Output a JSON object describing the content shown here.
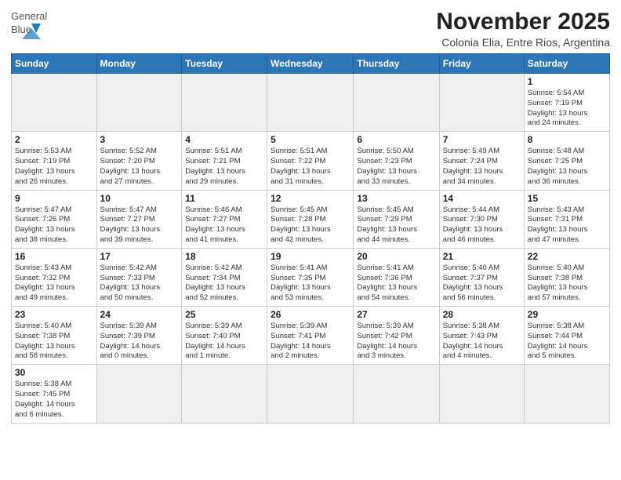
{
  "header": {
    "logo": {
      "general": "General",
      "blue": "Blue"
    },
    "month": "November 2025",
    "location": "Colonia Elia, Entre Rios, Argentina"
  },
  "weekdays": [
    "Sunday",
    "Monday",
    "Tuesday",
    "Wednesday",
    "Thursday",
    "Friday",
    "Saturday"
  ],
  "weeks": [
    [
      {
        "day": "",
        "info": ""
      },
      {
        "day": "",
        "info": ""
      },
      {
        "day": "",
        "info": ""
      },
      {
        "day": "",
        "info": ""
      },
      {
        "day": "",
        "info": ""
      },
      {
        "day": "",
        "info": ""
      },
      {
        "day": "1",
        "info": "Sunrise: 5:54 AM\nSunset: 7:19 PM\nDaylight: 13 hours\nand 24 minutes."
      }
    ],
    [
      {
        "day": "2",
        "info": "Sunrise: 5:53 AM\nSunset: 7:19 PM\nDaylight: 13 hours\nand 26 minutes."
      },
      {
        "day": "3",
        "info": "Sunrise: 5:52 AM\nSunset: 7:20 PM\nDaylight: 13 hours\nand 27 minutes."
      },
      {
        "day": "4",
        "info": "Sunrise: 5:51 AM\nSunset: 7:21 PM\nDaylight: 13 hours\nand 29 minutes."
      },
      {
        "day": "5",
        "info": "Sunrise: 5:51 AM\nSunset: 7:22 PM\nDaylight: 13 hours\nand 31 minutes."
      },
      {
        "day": "6",
        "info": "Sunrise: 5:50 AM\nSunset: 7:23 PM\nDaylight: 13 hours\nand 33 minutes."
      },
      {
        "day": "7",
        "info": "Sunrise: 5:49 AM\nSunset: 7:24 PM\nDaylight: 13 hours\nand 34 minutes."
      },
      {
        "day": "8",
        "info": "Sunrise: 5:48 AM\nSunset: 7:25 PM\nDaylight: 13 hours\nand 36 minutes."
      }
    ],
    [
      {
        "day": "9",
        "info": "Sunrise: 5:47 AM\nSunset: 7:26 PM\nDaylight: 13 hours\nand 38 minutes."
      },
      {
        "day": "10",
        "info": "Sunrise: 5:47 AM\nSunset: 7:27 PM\nDaylight: 13 hours\nand 39 minutes."
      },
      {
        "day": "11",
        "info": "Sunrise: 5:46 AM\nSunset: 7:27 PM\nDaylight: 13 hours\nand 41 minutes."
      },
      {
        "day": "12",
        "info": "Sunrise: 5:45 AM\nSunset: 7:28 PM\nDaylight: 13 hours\nand 42 minutes."
      },
      {
        "day": "13",
        "info": "Sunrise: 5:45 AM\nSunset: 7:29 PM\nDaylight: 13 hours\nand 44 minutes."
      },
      {
        "day": "14",
        "info": "Sunrise: 5:44 AM\nSunset: 7:30 PM\nDaylight: 13 hours\nand 46 minutes."
      },
      {
        "day": "15",
        "info": "Sunrise: 5:43 AM\nSunset: 7:31 PM\nDaylight: 13 hours\nand 47 minutes."
      }
    ],
    [
      {
        "day": "16",
        "info": "Sunrise: 5:43 AM\nSunset: 7:32 PM\nDaylight: 13 hours\nand 49 minutes."
      },
      {
        "day": "17",
        "info": "Sunrise: 5:42 AM\nSunset: 7:33 PM\nDaylight: 13 hours\nand 50 minutes."
      },
      {
        "day": "18",
        "info": "Sunrise: 5:42 AM\nSunset: 7:34 PM\nDaylight: 13 hours\nand 52 minutes."
      },
      {
        "day": "19",
        "info": "Sunrise: 5:41 AM\nSunset: 7:35 PM\nDaylight: 13 hours\nand 53 minutes."
      },
      {
        "day": "20",
        "info": "Sunrise: 5:41 AM\nSunset: 7:36 PM\nDaylight: 13 hours\nand 54 minutes."
      },
      {
        "day": "21",
        "info": "Sunrise: 5:40 AM\nSunset: 7:37 PM\nDaylight: 13 hours\nand 56 minutes."
      },
      {
        "day": "22",
        "info": "Sunrise: 5:40 AM\nSunset: 7:38 PM\nDaylight: 13 hours\nand 57 minutes."
      }
    ],
    [
      {
        "day": "23",
        "info": "Sunrise: 5:40 AM\nSunset: 7:38 PM\nDaylight: 13 hours\nand 58 minutes."
      },
      {
        "day": "24",
        "info": "Sunrise: 5:39 AM\nSunset: 7:39 PM\nDaylight: 14 hours\nand 0 minutes."
      },
      {
        "day": "25",
        "info": "Sunrise: 5:39 AM\nSunset: 7:40 PM\nDaylight: 14 hours\nand 1 minute."
      },
      {
        "day": "26",
        "info": "Sunrise: 5:39 AM\nSunset: 7:41 PM\nDaylight: 14 hours\nand 2 minutes."
      },
      {
        "day": "27",
        "info": "Sunrise: 5:39 AM\nSunset: 7:42 PM\nDaylight: 14 hours\nand 3 minutes."
      },
      {
        "day": "28",
        "info": "Sunrise: 5:38 AM\nSunset: 7:43 PM\nDaylight: 14 hours\nand 4 minutes."
      },
      {
        "day": "29",
        "info": "Sunrise: 5:38 AM\nSunset: 7:44 PM\nDaylight: 14 hours\nand 5 minutes."
      }
    ],
    [
      {
        "day": "30",
        "info": "Sunrise: 5:38 AM\nSunset: 7:45 PM\nDaylight: 14 hours\nand 6 minutes."
      },
      {
        "day": "",
        "info": ""
      },
      {
        "day": "",
        "info": ""
      },
      {
        "day": "",
        "info": ""
      },
      {
        "day": "",
        "info": ""
      },
      {
        "day": "",
        "info": ""
      },
      {
        "day": "",
        "info": ""
      }
    ]
  ]
}
